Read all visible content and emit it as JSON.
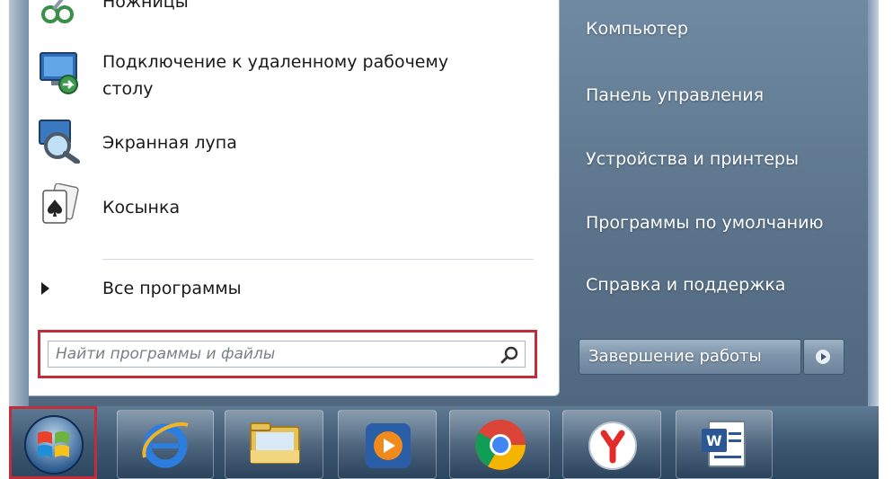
{
  "start_menu": {
    "programs": [
      {
        "label": "Ножницы",
        "icon": "scissors-icon"
      },
      {
        "label_line1": "Подключение к удаленному рабочему",
        "label_line2": "столу",
        "icon": "remote-desktop-icon"
      },
      {
        "label": "Экранная лупа",
        "icon": "magnifier-icon"
      },
      {
        "label": "Косынка",
        "icon": "solitaire-icon"
      }
    ],
    "all_programs_label": "Все программы",
    "search": {
      "placeholder": "Найти программы и файлы",
      "icon": "search-icon"
    },
    "right_items": [
      "Компьютер",
      "Панель управления",
      "Устройства и принтеры",
      "Программы по умолчанию",
      "Справка и поддержка"
    ],
    "shutdown_label": "Завершение работы"
  },
  "taskbar": {
    "start_icon": "windows-start-icon",
    "pinned": [
      "internet-explorer-icon",
      "file-explorer-icon",
      "media-player-icon",
      "chrome-icon",
      "yandex-browser-icon",
      "word-icon"
    ]
  },
  "colors": {
    "highlight": "#c12d3a",
    "menu_bg": "#5b748c",
    "taskbar_bg": "#3f5973"
  }
}
